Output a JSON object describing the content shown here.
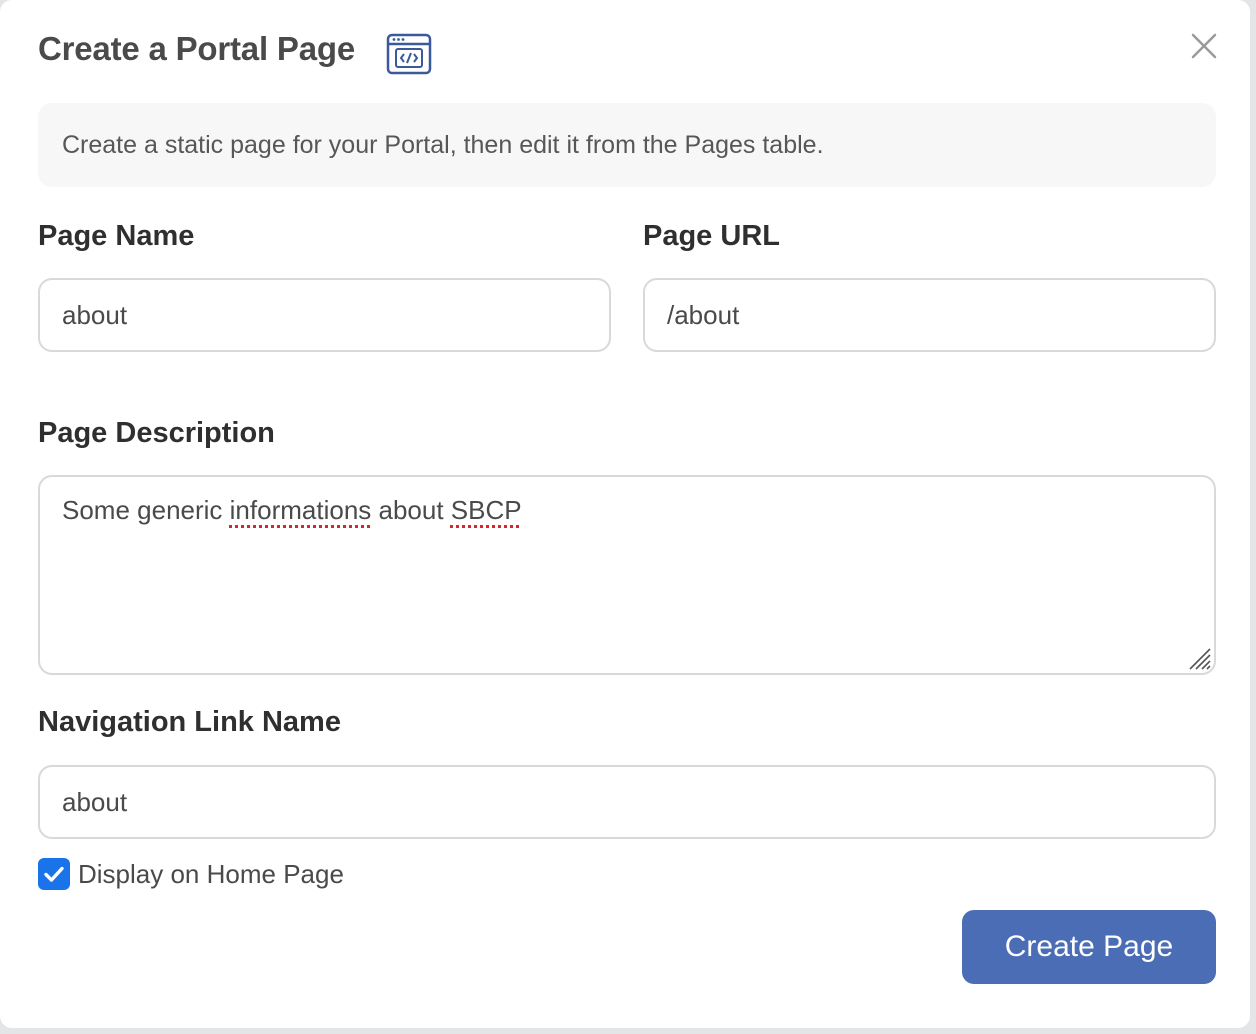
{
  "dialog": {
    "title": "Create a Portal Page",
    "title_icon": "browser-code-icon",
    "close_icon": "close-icon",
    "info_text": "Create a static page for your Portal, then edit it from the Pages table."
  },
  "form": {
    "page_name": {
      "label": "Page Name",
      "value": "about"
    },
    "page_url": {
      "label": "Page URL",
      "value": "/about"
    },
    "page_description": {
      "label": "Page Description",
      "value_parts": [
        "Some generic ",
        "informations",
        " about ",
        "SBCP"
      ]
    },
    "nav_link_name": {
      "label": "Navigation Link Name",
      "value": "about"
    },
    "display_on_home": {
      "label": "Display on Home Page",
      "checked": true
    }
  },
  "actions": {
    "create_label": "Create Page"
  },
  "colors": {
    "primary_button": "#4a6db5",
    "checkbox": "#1a73e8",
    "icon_accent": "#3a5a9c",
    "spellcheck": "#d9262a"
  }
}
